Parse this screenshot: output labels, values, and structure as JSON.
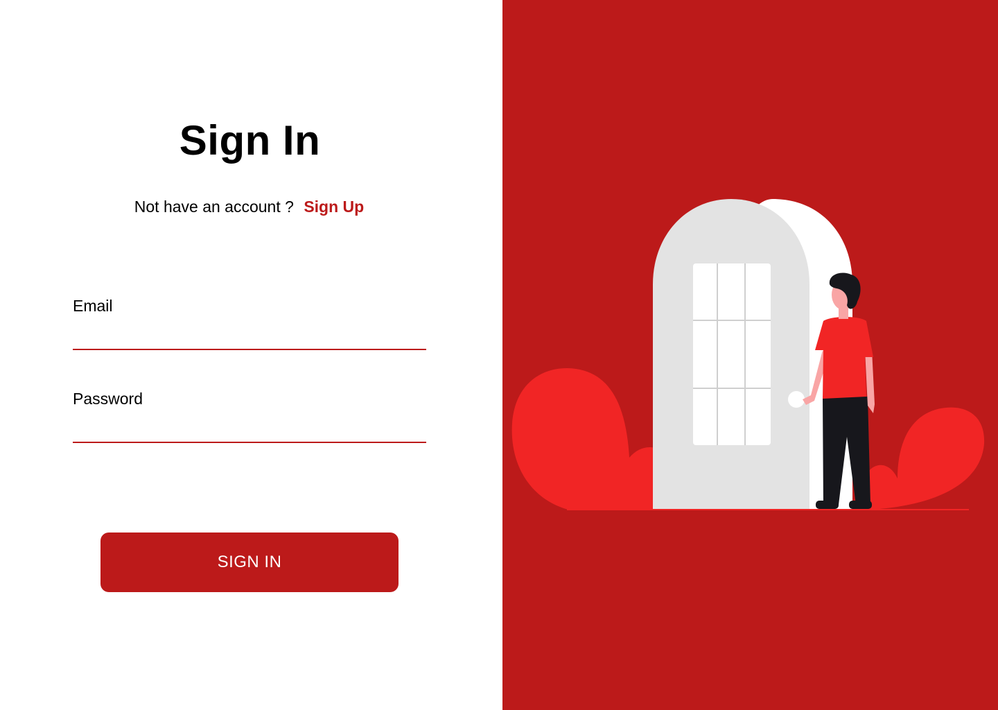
{
  "signin": {
    "title": "Sign In",
    "no_account_text": "Not have an account ?",
    "signup_link": "Sign Up",
    "email_label": "Email",
    "email_value": "",
    "password_label": "Password",
    "password_value": "",
    "button_label": "SIGN IN"
  },
  "colors": {
    "brand_red": "#bc1a1a",
    "accent_red": "#f12525",
    "door_gray": "#e3e3e3",
    "pants_dark": "#17171c",
    "skin": "#f9a5a5"
  },
  "illustration": {
    "icon": "person-at-door-illustration"
  }
}
